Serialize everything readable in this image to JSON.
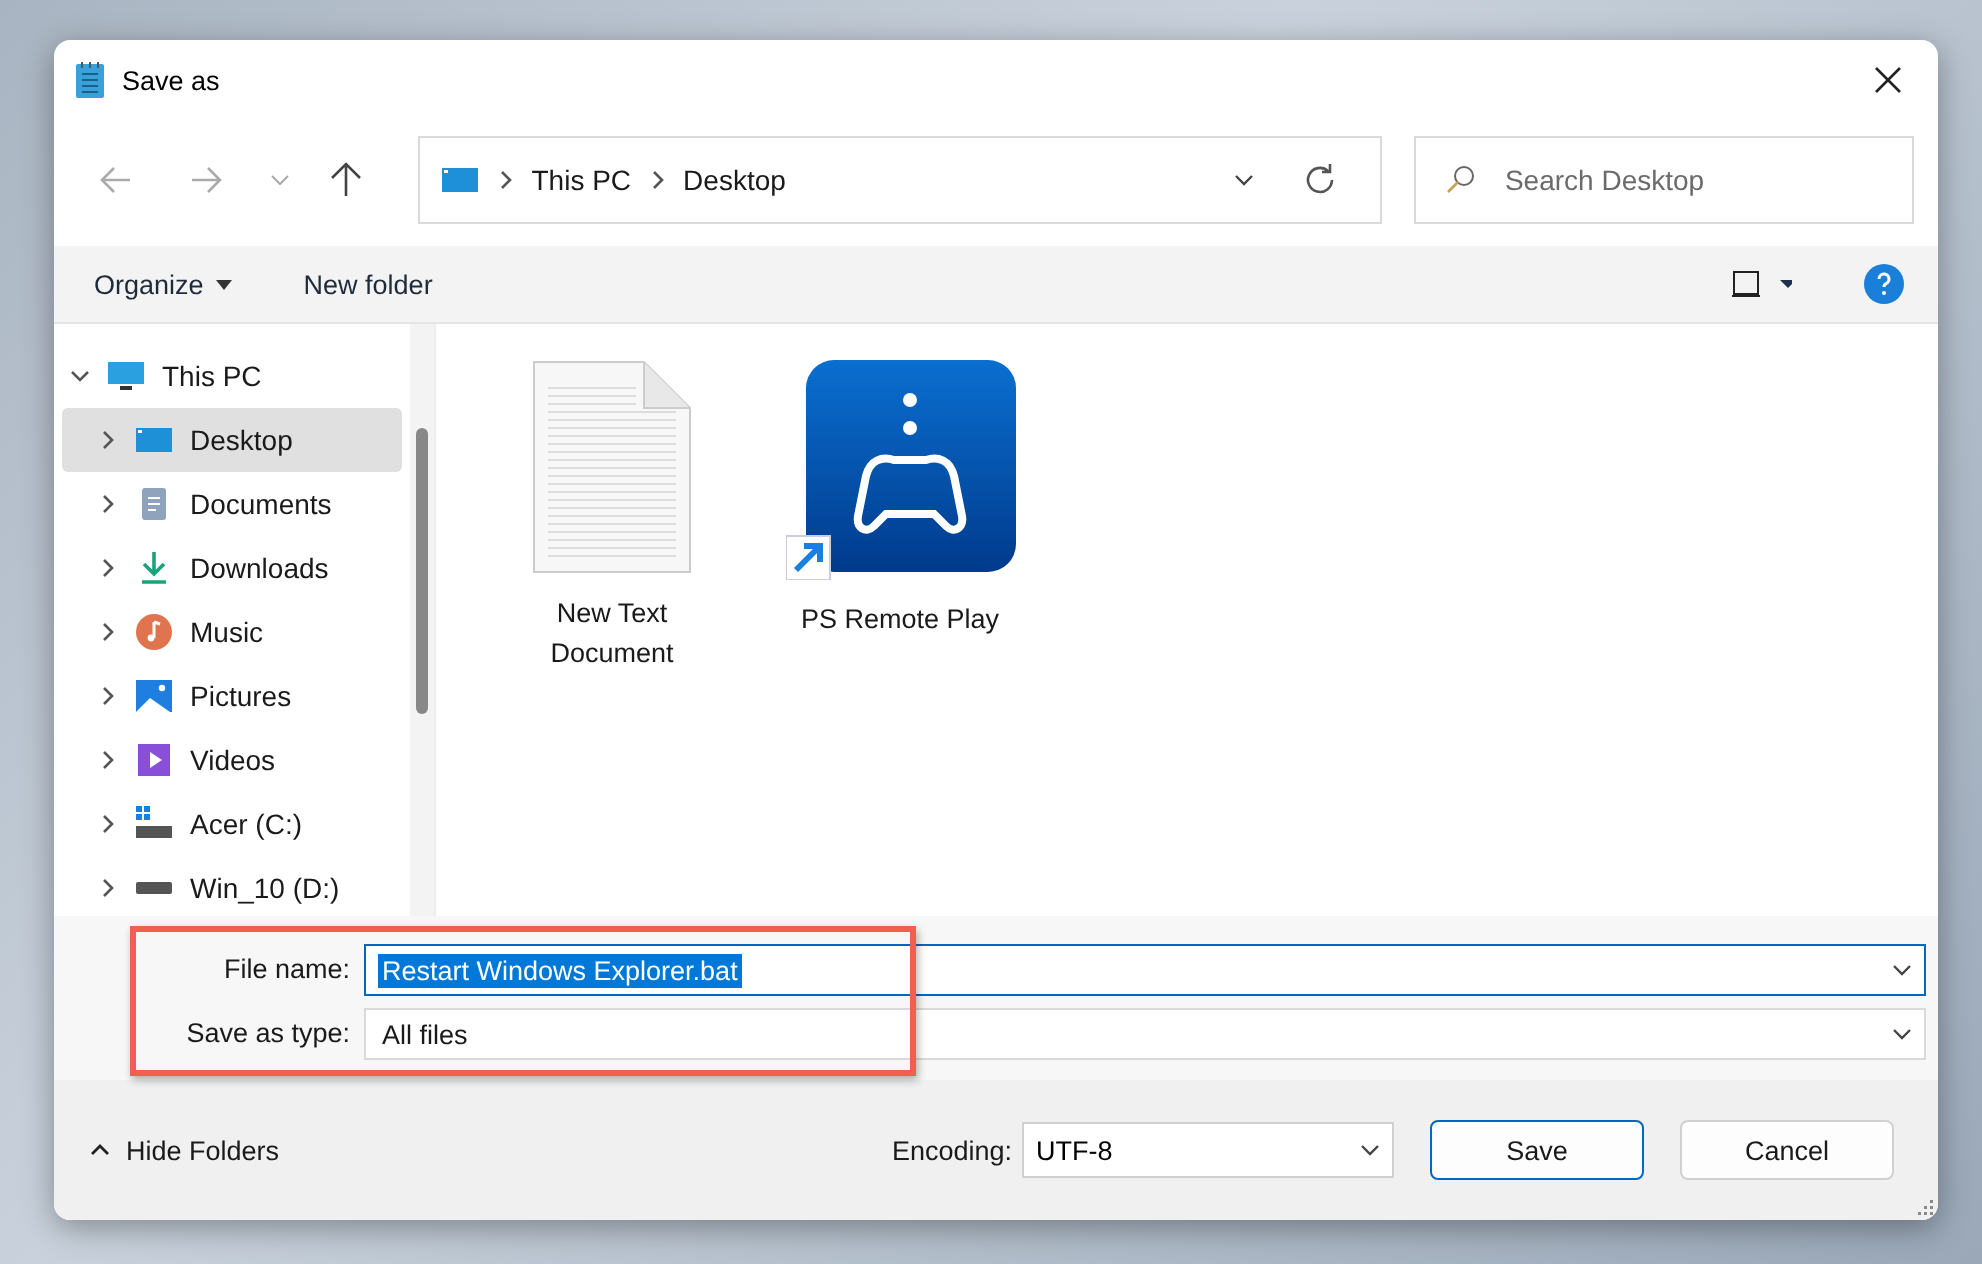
{
  "window": {
    "title": "Save as"
  },
  "nav": {
    "breadcrumb": [
      "This PC",
      "Desktop"
    ],
    "search": {
      "placeholder": "Search Desktop"
    }
  },
  "command_bar": {
    "organize": "Organize",
    "new_folder": "New folder"
  },
  "sidebar": {
    "items": [
      {
        "label": "This PC",
        "kind": "pc",
        "expanded": true,
        "selected": false,
        "children": [
          {
            "label": "Desktop",
            "kind": "desktop",
            "expanded": false,
            "selected": true
          },
          {
            "label": "Documents",
            "kind": "documents",
            "expanded": false,
            "selected": false
          },
          {
            "label": "Downloads",
            "kind": "downloads",
            "expanded": false,
            "selected": false
          },
          {
            "label": "Music",
            "kind": "music",
            "expanded": false,
            "selected": false
          },
          {
            "label": "Pictures",
            "kind": "pictures",
            "expanded": false,
            "selected": false
          },
          {
            "label": "Videos",
            "kind": "videos",
            "expanded": false,
            "selected": false
          },
          {
            "label": "Acer (C:)",
            "kind": "system-drive",
            "expanded": false,
            "selected": false
          },
          {
            "label": "Win_10 (D:)",
            "kind": "drive",
            "expanded": false,
            "selected": false
          }
        ]
      }
    ]
  },
  "files": [
    {
      "name": "New Text Document",
      "kind": "text"
    },
    {
      "name": "PS Remote Play",
      "kind": "shortcut"
    }
  ],
  "form": {
    "highlighted": true,
    "file_name": {
      "label": "File name:",
      "value": "Restart Windows Explorer.bat",
      "selected": true
    },
    "save_as_type": {
      "label": "Save as type:",
      "value": "All files"
    }
  },
  "footer": {
    "hide_folders": "Hide Folders",
    "encoding": {
      "label": "Encoding:",
      "value": "UTF-8"
    },
    "buttons": [
      "Save",
      "Cancel"
    ]
  }
}
